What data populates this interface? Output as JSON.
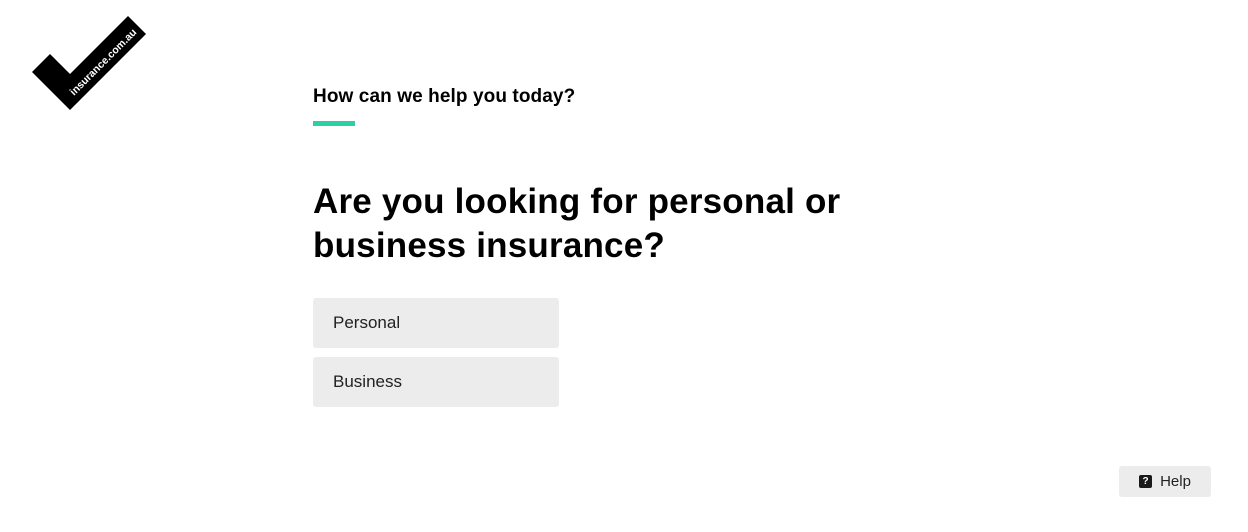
{
  "brand": {
    "logo_text": "insurance.com.au",
    "accent_color": "#2ecfa6"
  },
  "step": {
    "header": "How can we help you today?"
  },
  "question": {
    "text": "Are you looking for personal or business insurance?"
  },
  "options": [
    {
      "label": "Personal"
    },
    {
      "label": "Business"
    }
  ],
  "help": {
    "label": "Help",
    "icon": "question-icon"
  }
}
